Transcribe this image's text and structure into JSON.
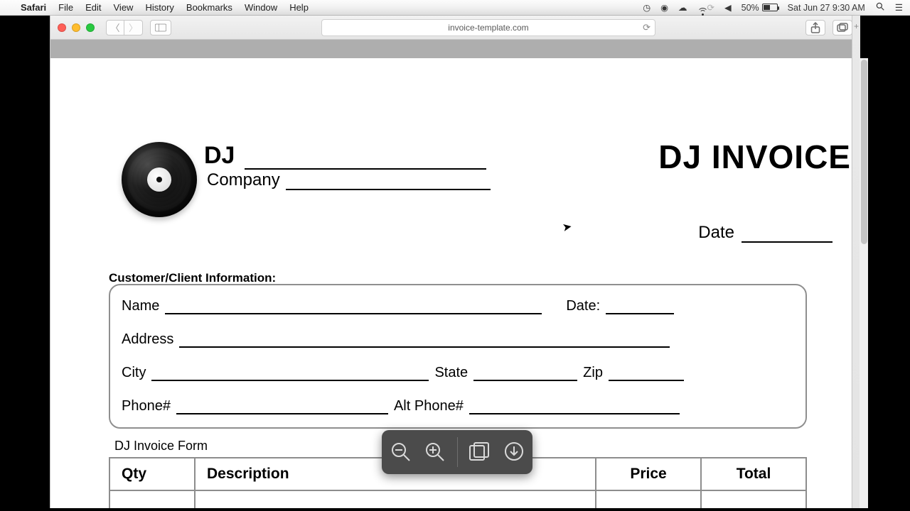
{
  "menubar": {
    "apple_glyph": "",
    "app_name": "Safari",
    "items": [
      "File",
      "Edit",
      "View",
      "History",
      "Bookmarks",
      "Window",
      "Help"
    ],
    "battery_percent": "50%",
    "datetime": "Sat Jun 27  9:30 AM"
  },
  "browser": {
    "url_display": "invoice-template.com"
  },
  "invoice": {
    "dj_label": "DJ",
    "company_label": "Company",
    "title": "DJ INVOICE",
    "date_label": "Date",
    "section_header": "Customer/Client Information:",
    "fields": {
      "name": "Name",
      "date": "Date:",
      "address": "Address",
      "city": "City",
      "state": "State",
      "zip": "Zip",
      "phone": "Phone#",
      "alt_phone": "Alt Phone#"
    },
    "form_caption": "DJ Invoice Form",
    "columns": {
      "qty": "Qty",
      "description": "Description",
      "price": "Price",
      "total": "Total"
    }
  },
  "pdf_toolbar": {
    "zoom_out": "zoom-out",
    "zoom_in": "zoom-in",
    "open_preview": "open-in-preview",
    "download": "download"
  }
}
